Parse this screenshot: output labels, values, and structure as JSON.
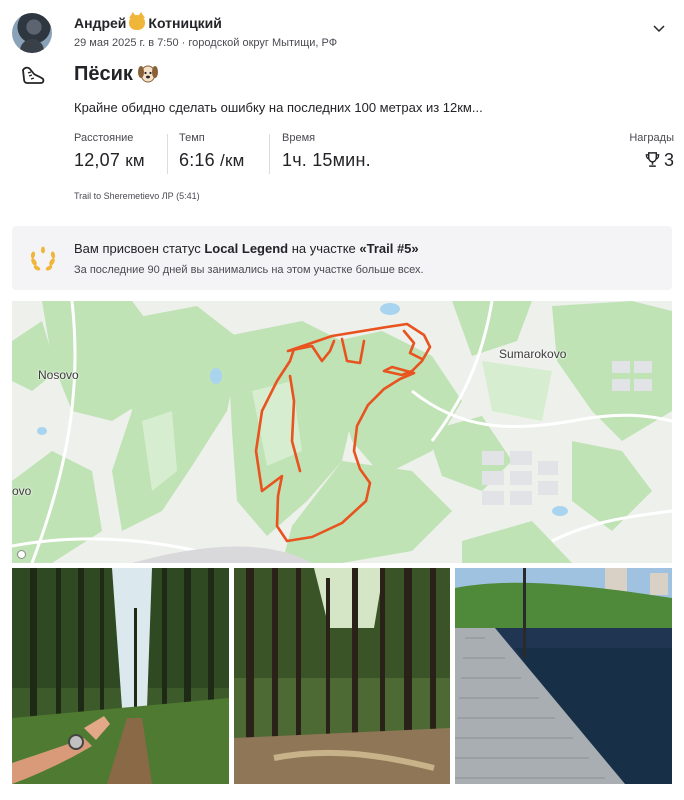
{
  "athlete": {
    "name_first": "Андрей",
    "name_last": "Котницкий",
    "emoji_icon": "cat-face-icon",
    "datetime": "29 мая 2025 г. в 7:50",
    "separator": "·",
    "location": "городской округ Мытищи, РФ"
  },
  "activity": {
    "sport_icon": "running-shoe-icon",
    "title": "Пёсик",
    "title_emoji_icon": "dog-face-icon",
    "description": "Крайне обидно сделать ошибку на последних 100 метрах из 12км..."
  },
  "stats": [
    {
      "label": "Расстояние",
      "value": "12,07",
      "unit": "км"
    },
    {
      "label": "Темп",
      "value": "6:16",
      "unit": "/км"
    },
    {
      "label": "Время",
      "value": "1ч. 15мин.",
      "unit": ""
    }
  ],
  "awards": {
    "label": "Награды",
    "icon": "trophy-icon",
    "count": "3"
  },
  "segment_note": "Trail to Sheremetievo ЛР (5:41)",
  "local_legend": {
    "icon": "laurel-wreath-icon",
    "title_prefix": "Вам присвоен статус ",
    "status": "Local Legend",
    "title_middle": " на участке ",
    "segment": "«Trail #5»",
    "subtitle": "За последние 90 дней вы занимались на этом участке больше всех."
  },
  "map": {
    "labels": {
      "left": "Nosovo",
      "right": "Sumarokovo",
      "edge": "ovo"
    },
    "route_color": "#e8531f",
    "forest_color": "#b9dfb0",
    "water_color": "#a9d4ef"
  },
  "photos": [
    {
      "alt_icon": "forest-path-hand-watch-photo"
    },
    {
      "alt_icon": "pine-forest-photo"
    },
    {
      "alt_icon": "boardwalk-pond-photo"
    }
  ]
}
